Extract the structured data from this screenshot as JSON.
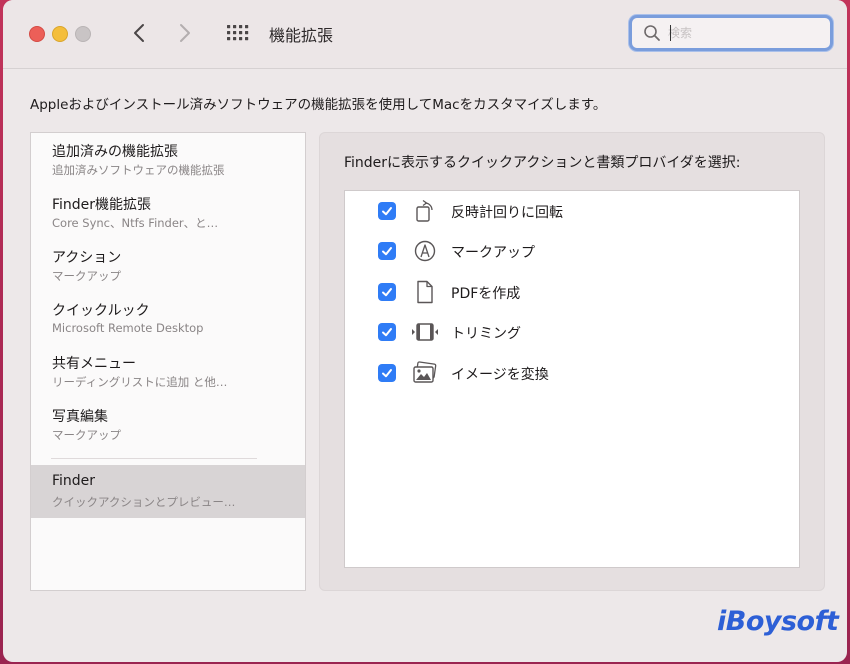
{
  "window": {
    "title": "機能拡張",
    "search_placeholder": "検索"
  },
  "description": "Appleおよびインストール済みソフトウェアの機能拡張を使用してMacをカスタマイズします。",
  "sidebar": {
    "items": [
      {
        "title": "追加済みの機能拡張",
        "subtitle": "追加済みソフトウェアの機能拡張"
      },
      {
        "title": "Finder機能拡張",
        "subtitle": "Core Sync、Ntfs Finder、と…"
      },
      {
        "title": "アクション",
        "subtitle": "マークアップ"
      },
      {
        "title": "クイックルック",
        "subtitle": "Microsoft Remote Desktop"
      },
      {
        "title": "共有メニュー",
        "subtitle": "リーディングリストに追加 と他…"
      },
      {
        "title": "写真編集",
        "subtitle": "マークアップ"
      },
      {
        "title": "Finder",
        "subtitle": "クイックアクションとプレビュー…"
      }
    ],
    "selected_index": 6
  },
  "panel": {
    "label": "Finderに表示するクイックアクションと書類プロバイダを選択:",
    "actions": [
      {
        "label": "反時計回りに回転",
        "icon": "rotate-left-icon",
        "checked": true
      },
      {
        "label": "マークアップ",
        "icon": "markup-icon",
        "checked": true
      },
      {
        "label": "PDFを作成",
        "icon": "document-icon",
        "checked": true
      },
      {
        "label": "トリミング",
        "icon": "trim-icon",
        "checked": true
      },
      {
        "label": "イメージを変換",
        "icon": "photos-icon",
        "checked": true
      }
    ]
  },
  "watermark": "iBoysoft",
  "colors": {
    "accent": "#2f7cf6",
    "selection": "#d8d4d5",
    "watermark": "#2d5fd6"
  }
}
